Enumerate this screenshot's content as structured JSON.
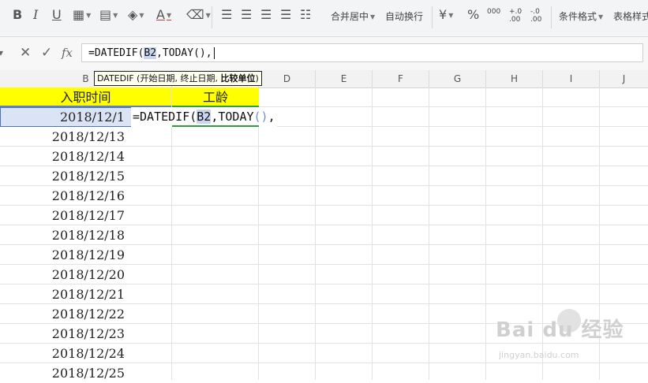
{
  "ribbon": {
    "merge_center_label": "合并居中",
    "wrap_text_label": "自动换行",
    "conditional_format_label": "条件格式",
    "table_style_label": "表格样式",
    "percent_symbol": "%",
    "thousands_symbol": "000",
    "increase_decimal": "+.0 .00",
    "decrease_decimal": "-.0 .00"
  },
  "formula_bar": {
    "cancel_symbol": "✕",
    "confirm_symbol": "✓",
    "fx_label": "fx",
    "formula_prefix": "=DATEDIF(",
    "formula_ref": "B2",
    "formula_suffix": ",TODAY(),"
  },
  "columns": [
    "B",
    "C",
    "D",
    "E",
    "F",
    "G",
    "H",
    "I",
    "J"
  ],
  "tooltip": {
    "fn_name": "DATEDIF",
    "args_plain": " (开始日期, 终止日期, ",
    "arg_current": "比较单位",
    "close": ")"
  },
  "grid": {
    "header_hire_date": "入职时间",
    "header_seniority": "工龄",
    "edit_prefix": "=DATEDIF(",
    "edit_ref": "B2",
    "edit_middle": ",TODAY",
    "edit_parens": "()",
    "edit_suffix": ",",
    "dates": [
      "2018/12/1",
      "2018/12/13",
      "2018/12/14",
      "2018/12/15",
      "2018/12/16",
      "2018/12/17",
      "2018/12/18",
      "2018/12/19",
      "2018/12/20",
      "2018/12/21",
      "2018/12/22",
      "2018/12/23",
      "2018/12/24",
      "2018/12/25"
    ]
  },
  "watermark": {
    "brand": "Bai du 经验",
    "url": "jingyan.baidu.com"
  },
  "colors": {
    "header_fill": "#ffff00",
    "active_ref_fill": "#dbe4f5",
    "ref_border": "#4a73c7",
    "edit_border": "#2e9e3f"
  }
}
